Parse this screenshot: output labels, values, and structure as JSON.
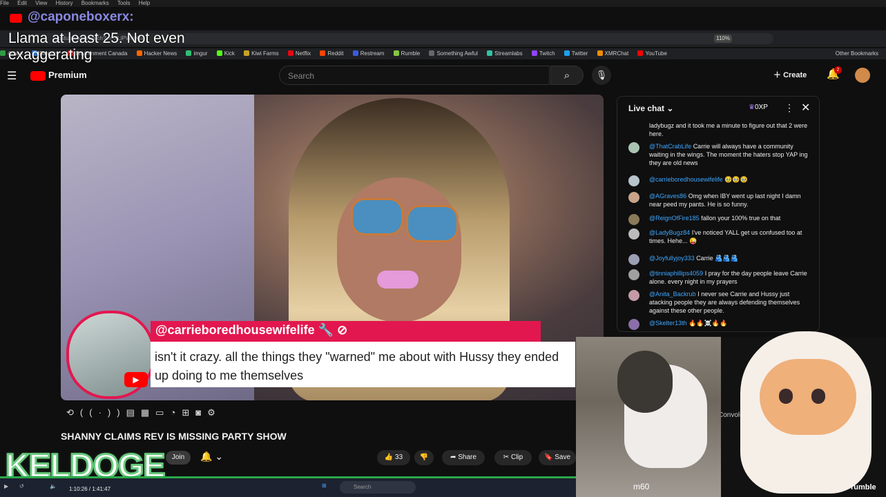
{
  "browser": {
    "menu": [
      "File",
      "Edit",
      "View",
      "History",
      "Bookmarks",
      "Tools",
      "Help"
    ],
    "url": "youtube.com/watch?v=-XLiPWrkXsI",
    "zoom": "110%",
    "bookmarks": [
      {
        "label": "4chan",
        "color": "#2f9e44"
      },
      {
        "label": "Bluesky",
        "color": "#3e8cf0"
      },
      {
        "label": "Environment Canada",
        "color": "#e03131"
      },
      {
        "label": "Hacker News",
        "color": "#ff6600"
      },
      {
        "label": "imgur",
        "color": "#2fbf71"
      },
      {
        "label": "Kick",
        "color": "#53fc18"
      },
      {
        "label": "Kiwi Farms",
        "color": "#c9a227"
      },
      {
        "label": "Netflix",
        "color": "#e50914"
      },
      {
        "label": "Reddit",
        "color": "#ff4500"
      },
      {
        "label": "Restream",
        "color": "#3b5bdb"
      },
      {
        "label": "Rumble",
        "color": "#85c742"
      },
      {
        "label": "Something Awful",
        "color": "#666666"
      },
      {
        "label": "Streamlabs",
        "color": "#31c3a2"
      },
      {
        "label": "Twitch",
        "color": "#9146ff"
      },
      {
        "label": "Twitter",
        "color": "#1da1f2"
      },
      {
        "label": "XMRChat",
        "color": "#f08c00"
      },
      {
        "label": "YouTube",
        "color": "#ff0000"
      }
    ],
    "other_bookmarks": "Other Bookmarks"
  },
  "overlay": {
    "handle": "@caponeboxerx:",
    "message": "Llama at least 25. Not even exaggerating"
  },
  "youtube": {
    "brand": "Premium",
    "search_placeholder": "Search",
    "create_label": "Create",
    "notif_count": "2"
  },
  "video": {
    "title": "SHANNY CLAIMS REV IS MISSING PARTY SHOW",
    "join_label": "Join",
    "like_count": "33",
    "share_label": "Share",
    "clip_label": "Clip",
    "save_label": "Save",
    "time": "1:10:26 / 1:41:47"
  },
  "comment_overlay": {
    "username": "@carrieboredhousewifelife",
    "text": "isn't it crazy. all the things they \"warned\" me about with Hussy they ended up doing to me themselves"
  },
  "live_chat": {
    "title": "Live chat",
    "xp": "0XP",
    "messages": [
      {
        "user": "",
        "text": "ladybugz and it took me a minute to figure out that 2 were here."
      },
      {
        "user": "@ThatCrabLife",
        "text": "Carrie will always have a community waiting in the wings. The moment the haters stop YAP ing they are old news"
      },
      {
        "user": "@carrieboredhousewifelife",
        "text": "🥹🥹🥹"
      },
      {
        "user": "@AGraves86",
        "text": "Omg when IBY went up last night I damn near peed my pants. He is so funny."
      },
      {
        "user": "@ReignOfFire185",
        "text": "fallon your 100% true on that"
      },
      {
        "user": "@LadyBugz84",
        "text": "I've noticed YALL get us confused too at times. Hehe... 😜"
      },
      {
        "user": "@Joyfullyjoy333",
        "text": "Carrie 🫂🫂🫂"
      },
      {
        "user": "@tinniaphillips4059",
        "text": "I pray for the day people leave Carrie alone. every night in my prayers"
      },
      {
        "user": "@Anita_Backrub",
        "text": "I never see Carrie and Hussy just atacking people they are always defending themselves against these other people."
      },
      {
        "user": "@Skelter13th",
        "text": "🔥🔥☠️🔥🔥"
      }
    ],
    "peek_text": "Convoluted"
  },
  "stream": {
    "keldoge": "KELDOGE",
    "cat_caption": "m60",
    "rumble": "rumble",
    "taskbar_search": "Search"
  }
}
